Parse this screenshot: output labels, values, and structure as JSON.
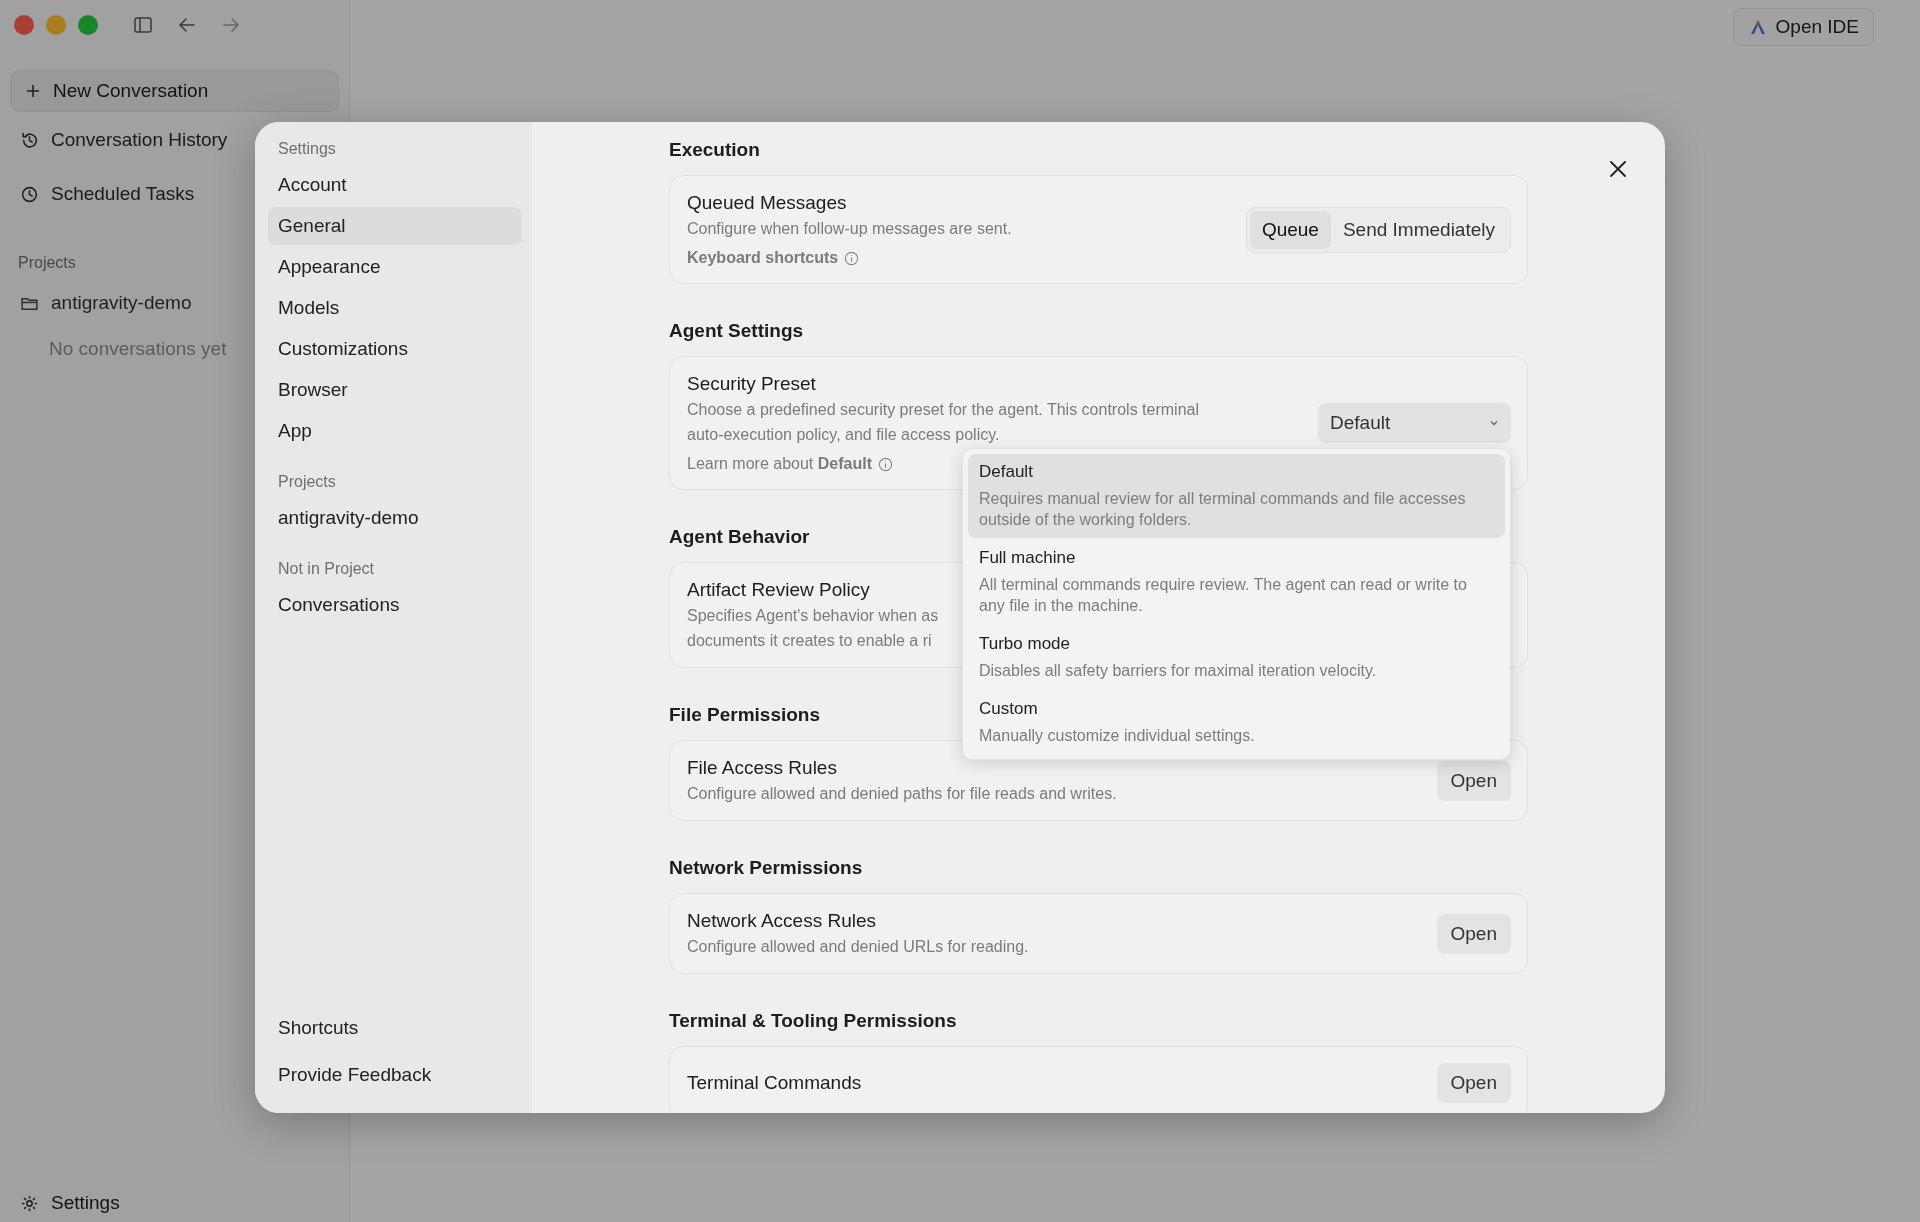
{
  "sidebar": {
    "new_button": "New Conversation",
    "items": [
      {
        "kind": "history",
        "label": "Conversation History"
      },
      {
        "kind": "clock",
        "label": "Scheduled Tasks"
      }
    ],
    "projects_label": "Projects",
    "projects": [
      {
        "name": "antigravity-demo",
        "empty_text": "No conversations yet"
      }
    ],
    "footer": "Settings"
  },
  "top_bar": {
    "open_ide": "Open IDE"
  },
  "settings_dialog": {
    "nav_title": "Settings",
    "nav_items": [
      {
        "label": "Account",
        "selected": false
      },
      {
        "label": "General",
        "selected": true
      },
      {
        "label": "Appearance",
        "selected": false
      },
      {
        "label": "Models",
        "selected": false
      },
      {
        "label": "Customizations",
        "selected": false
      },
      {
        "label": "Browser",
        "selected": false
      },
      {
        "label": "App",
        "selected": false
      }
    ],
    "projects_label": "Projects",
    "project_items": [
      {
        "label": "antigravity-demo",
        "selected": false
      }
    ],
    "other_label": "Not in Project",
    "other_items": [
      {
        "label": "Conversations",
        "selected": false
      }
    ],
    "footer_items": [
      {
        "label": "Shortcuts"
      },
      {
        "label": "Provide Feedback"
      }
    ],
    "sections": [
      {
        "heading": "Execution",
        "rows": [
          {
            "kind": "segmented",
            "title": "Queued Messages",
            "description": [
              "Configure when follow-up messages are sent."
            ],
            "link": "Keyboard shortcuts",
            "options": [
              {
                "label": "Queue",
                "selected": true
              },
              {
                "label": "Send Immediately",
                "selected": false
              }
            ]
          }
        ]
      },
      {
        "heading": "Agent Settings",
        "rows": [
          {
            "kind": "select",
            "title": "Security Preset",
            "description": [
              "Choose a predefined security preset for the agent. This controls terminal",
              "auto-execution policy, and file access policy."
            ],
            "learn_more": "Learn more about **Default**",
            "value": "Default",
            "menu": [
              {
                "label": "Default",
                "description": "Requires manual review for all terminal commands and file accesses outside of the working folders.",
                "selected": true
              },
              {
                "label": "Full machine",
                "description": "All terminal commands require review. The agent can read or write to any file in the machine.",
                "selected": false
              },
              {
                "label": "Turbo mode",
                "description": "Disables all safety barriers for maximal iteration velocity.",
                "selected": false
              },
              {
                "label": "Custom",
                "description": "Manually customize individual settings.",
                "selected": false
              }
            ]
          }
        ]
      },
      {
        "heading": "Agent Behavior",
        "rows": [
          {
            "kind": "covered",
            "title": "Artifact Review Policy",
            "description": [
              "Specifies Agent's behavior when as",
              "documents it creates to enable a ri"
            ]
          }
        ]
      },
      {
        "heading": "File Permissions",
        "rows": [
          {
            "kind": "open",
            "title": "File Access Rules",
            "description": [
              "Configure allowed and denied paths for file reads and writes."
            ],
            "button": "Open"
          }
        ]
      },
      {
        "heading": "Network Permissions",
        "rows": [
          {
            "kind": "open",
            "title": "Network Access Rules",
            "description": [
              "Configure allowed and denied URLs for reading."
            ],
            "button": "Open"
          }
        ]
      },
      {
        "heading": "Terminal & Tooling Permissions",
        "rows": [
          {
            "kind": "open",
            "title": "Terminal Commands",
            "button": "Open"
          }
        ]
      }
    ]
  }
}
